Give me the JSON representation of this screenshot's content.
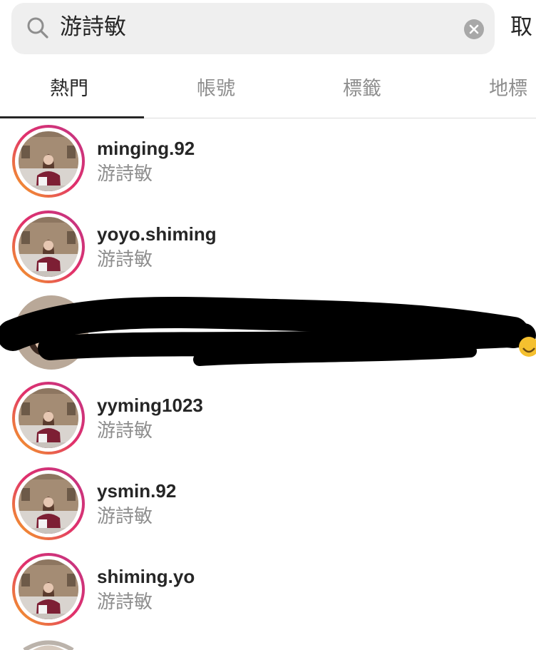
{
  "search": {
    "query": "游詩敏",
    "cancel_label": "取"
  },
  "tabs": [
    {
      "label": "熱門",
      "active": true
    },
    {
      "label": "帳號",
      "active": false
    },
    {
      "label": "標籤",
      "active": false
    },
    {
      "label": "地標",
      "active": false
    }
  ],
  "results": [
    {
      "username": "minging.92",
      "full_name": "游詩敏"
    },
    {
      "username": "yoyo.shiming",
      "full_name": "游詩敏"
    },
    {
      "username": "yyming1023",
      "full_name": "游詩敏"
    },
    {
      "username": "ysmin.92",
      "full_name": "游詩敏"
    },
    {
      "username": "shiming.yo",
      "full_name": "游詩敏"
    }
  ],
  "colors": {
    "search_bg": "#efefef",
    "text_primary": "#262626",
    "text_secondary": "#8e8e8e",
    "story_ring_start": "#c13584",
    "story_ring_end": "#f5a623",
    "redaction": "#000000"
  },
  "icons": {
    "search": "magnifier-icon",
    "clear": "clear-circle-x-icon",
    "story_ring": "gradient-ring"
  }
}
